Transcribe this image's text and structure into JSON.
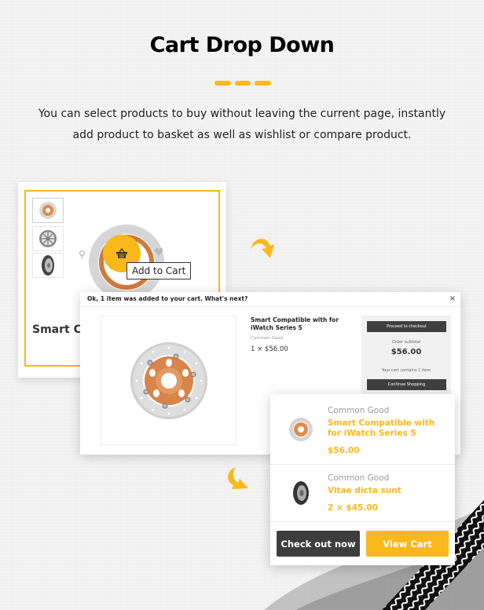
{
  "header": {
    "title": "Cart Drop Down",
    "description": "You can select products to buy without leaving the current page, instantly add product to basket as well as wishlist or compare product."
  },
  "colors": {
    "accent": "#fbb81b",
    "dark_button": "#3d3d3d",
    "background": "#f2f2f2"
  },
  "product_card": {
    "thumbnails": [
      {
        "icon": "brake-disc-icon",
        "active": true
      },
      {
        "icon": "alloy-wheel-icon",
        "active": false
      },
      {
        "icon": "tire-icon",
        "active": false
      }
    ],
    "quick_view_icon": "search-icon",
    "wishlist_icon": "heart-icon",
    "add_to_cart_icon": "basket-icon",
    "tooltip": "Add to Cart",
    "product_name_partial": "Smart Co"
  },
  "modal": {
    "title": "Ok, 1 item was added to your cart. What's next?",
    "close_icon": "×",
    "product": {
      "name": "Smart Compatible with for iWatch Series 5",
      "brand": "Common Good",
      "quantity_price": "1 × $56.00"
    },
    "summary": {
      "checkout_button": "Proceed to checkout",
      "subtotal_label": "Order subtotal",
      "subtotal_value": "$56.00",
      "cart_count_text": "Your cart contains 1 item",
      "continue_button": "Continue Shopping"
    }
  },
  "dropdown": {
    "items": [
      {
        "brand": "Common Good",
        "name": "Smart Compatible with for iWatch Series 5",
        "price": "$56.00",
        "image": "brake-disc"
      },
      {
        "brand": "Common Good",
        "name": "Vitae dicta sunt",
        "price": "2 × $45.00",
        "image": "tire"
      }
    ],
    "checkout_button": "Check out now",
    "view_cart_button": "View Cart"
  }
}
